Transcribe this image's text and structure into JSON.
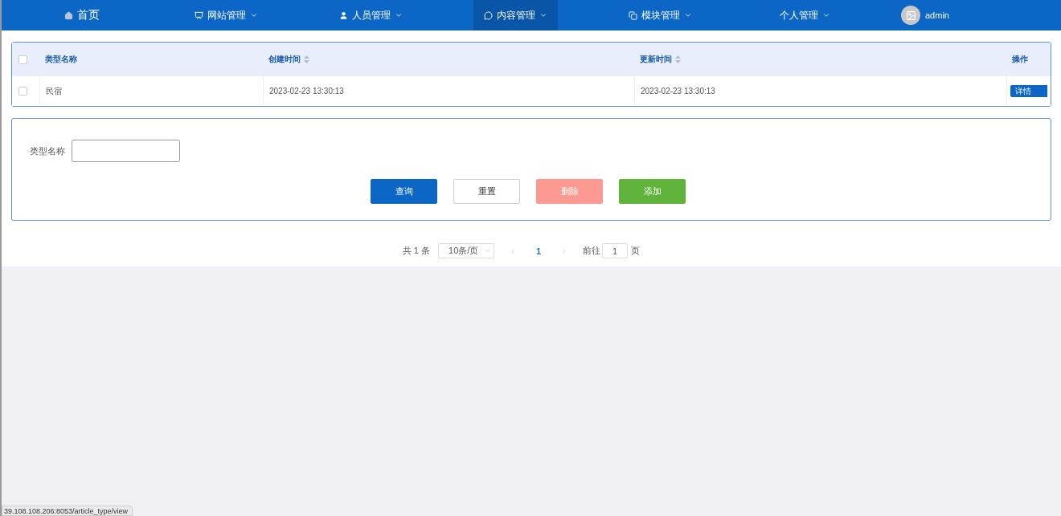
{
  "nav": {
    "items": [
      {
        "label": "首页",
        "selected": false
      },
      {
        "label": "网站管理",
        "selected": false
      },
      {
        "label": "人员管理",
        "selected": false
      },
      {
        "label": "内容管理",
        "selected": true
      },
      {
        "label": "模块管理",
        "selected": false
      },
      {
        "label": "个人管理",
        "selected": false
      }
    ],
    "user": {
      "name": "admin"
    }
  },
  "table": {
    "header_checked": false,
    "columns": [
      "类型名称",
      "创建时间",
      "更新时间",
      "操作"
    ],
    "rows": [
      {
        "checked": false,
        "cells": [
          "民宿",
          "2023-02-23 13:30:13",
          "2023-02-23 13:30:13"
        ],
        "action": "详情"
      }
    ]
  },
  "search": {
    "label": "类型名称",
    "buttons": [
      {
        "label": "查询",
        "kind": "primary"
      },
      {
        "label": "重置",
        "kind": "default"
      },
      {
        "label": "删除",
        "kind": "danger"
      },
      {
        "label": "添加",
        "kind": "success"
      }
    ]
  },
  "pagination": {
    "total": "共 1 条",
    "page_size": "10条/页",
    "pages": [
      {
        "label": "1",
        "selected": true
      }
    ],
    "goto_label": "前往",
    "goto_value": "1",
    "goto_suffix": "页"
  },
  "status_bar": {
    "url": "39.108.108.206:8053/article_type/view"
  }
}
